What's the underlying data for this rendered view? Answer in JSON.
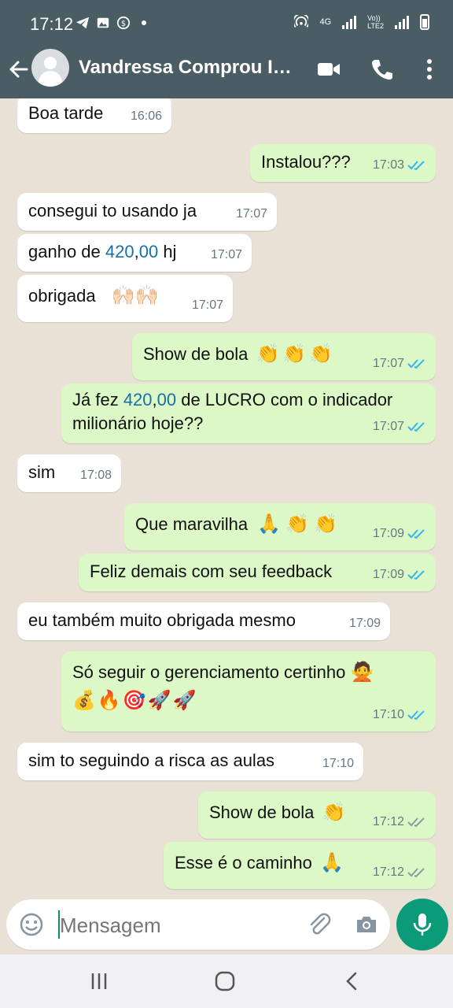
{
  "status_bar": {
    "time": "17:12",
    "network_4g": "4G",
    "volte": "Vo))\nLTE2"
  },
  "header": {
    "contact_name": "Vandressa Comprou In...",
    "icons": [
      "back-arrow-icon",
      "avatar",
      "video-call-icon",
      "phone-icon",
      "more-vert-icon"
    ]
  },
  "colors": {
    "header": "#4a5c64",
    "outgoing_bubble": "#dcf8c6",
    "incoming_bubble": "#ffffff",
    "read_ticks": "#34b7f1",
    "mic_button": "#0c9b79"
  },
  "messages": [
    {
      "dir": "in",
      "text": "Boa tarde",
      "time": "16:06"
    },
    {
      "dir": "out",
      "text": "Instalou???",
      "time": "17:03",
      "status": "read"
    },
    {
      "dir": "in",
      "text": "consegui to usando ja",
      "time": "17:07"
    },
    {
      "dir": "in",
      "text_pre": "ganho de ",
      "text_num_a": "420",
      "text_sep": ",",
      "text_num_b": "00",
      "text_post": " hj",
      "time": "17:07"
    },
    {
      "dir": "in",
      "text": "obrigada",
      "emoji": "🙌🏻🙌🏻",
      "time": "17:07"
    },
    {
      "dir": "out",
      "text": "Show de bola",
      "emoji": "👏👏👏",
      "time": "17:07",
      "status": "read"
    },
    {
      "dir": "out",
      "text_pre": "Já fez ",
      "text_num_a": "420",
      "text_sep": ",",
      "text_num_b": "00",
      "text_post": " de LUCRO com o indicador",
      "text_line2": "milionário hoje??",
      "time": "17:07",
      "status": "read"
    },
    {
      "dir": "in",
      "text": "sim",
      "time": "17:08"
    },
    {
      "dir": "out",
      "text": "Que maravilha",
      "emoji": "🙏👏👏",
      "time": "17:09",
      "status": "read"
    },
    {
      "dir": "out",
      "text": "Feliz demais com seu feedback",
      "time": "17:09",
      "status": "read"
    },
    {
      "dir": "in",
      "text": "eu também muito obrigada mesmo",
      "time": "17:09"
    },
    {
      "dir": "out",
      "text": "Só seguir o gerenciamento certinho",
      "emoji": "🙅",
      "text_line2_emoji": "💰🔥🎯🚀🚀",
      "time": "17:10",
      "status": "read"
    },
    {
      "dir": "in",
      "text": "sim to seguindo a risca as aulas",
      "time": "17:10"
    },
    {
      "dir": "out",
      "text": "Show de bola",
      "emoji": "👏",
      "time": "17:12",
      "status": "delivered"
    },
    {
      "dir": "out",
      "text": "Esse é o caminho",
      "emoji": "🙏",
      "time": "17:12",
      "status": "delivered"
    }
  ],
  "input": {
    "placeholder": "Mensagem"
  },
  "navbar": {
    "icons": [
      "recent-apps-icon",
      "home-icon",
      "back-icon"
    ]
  }
}
